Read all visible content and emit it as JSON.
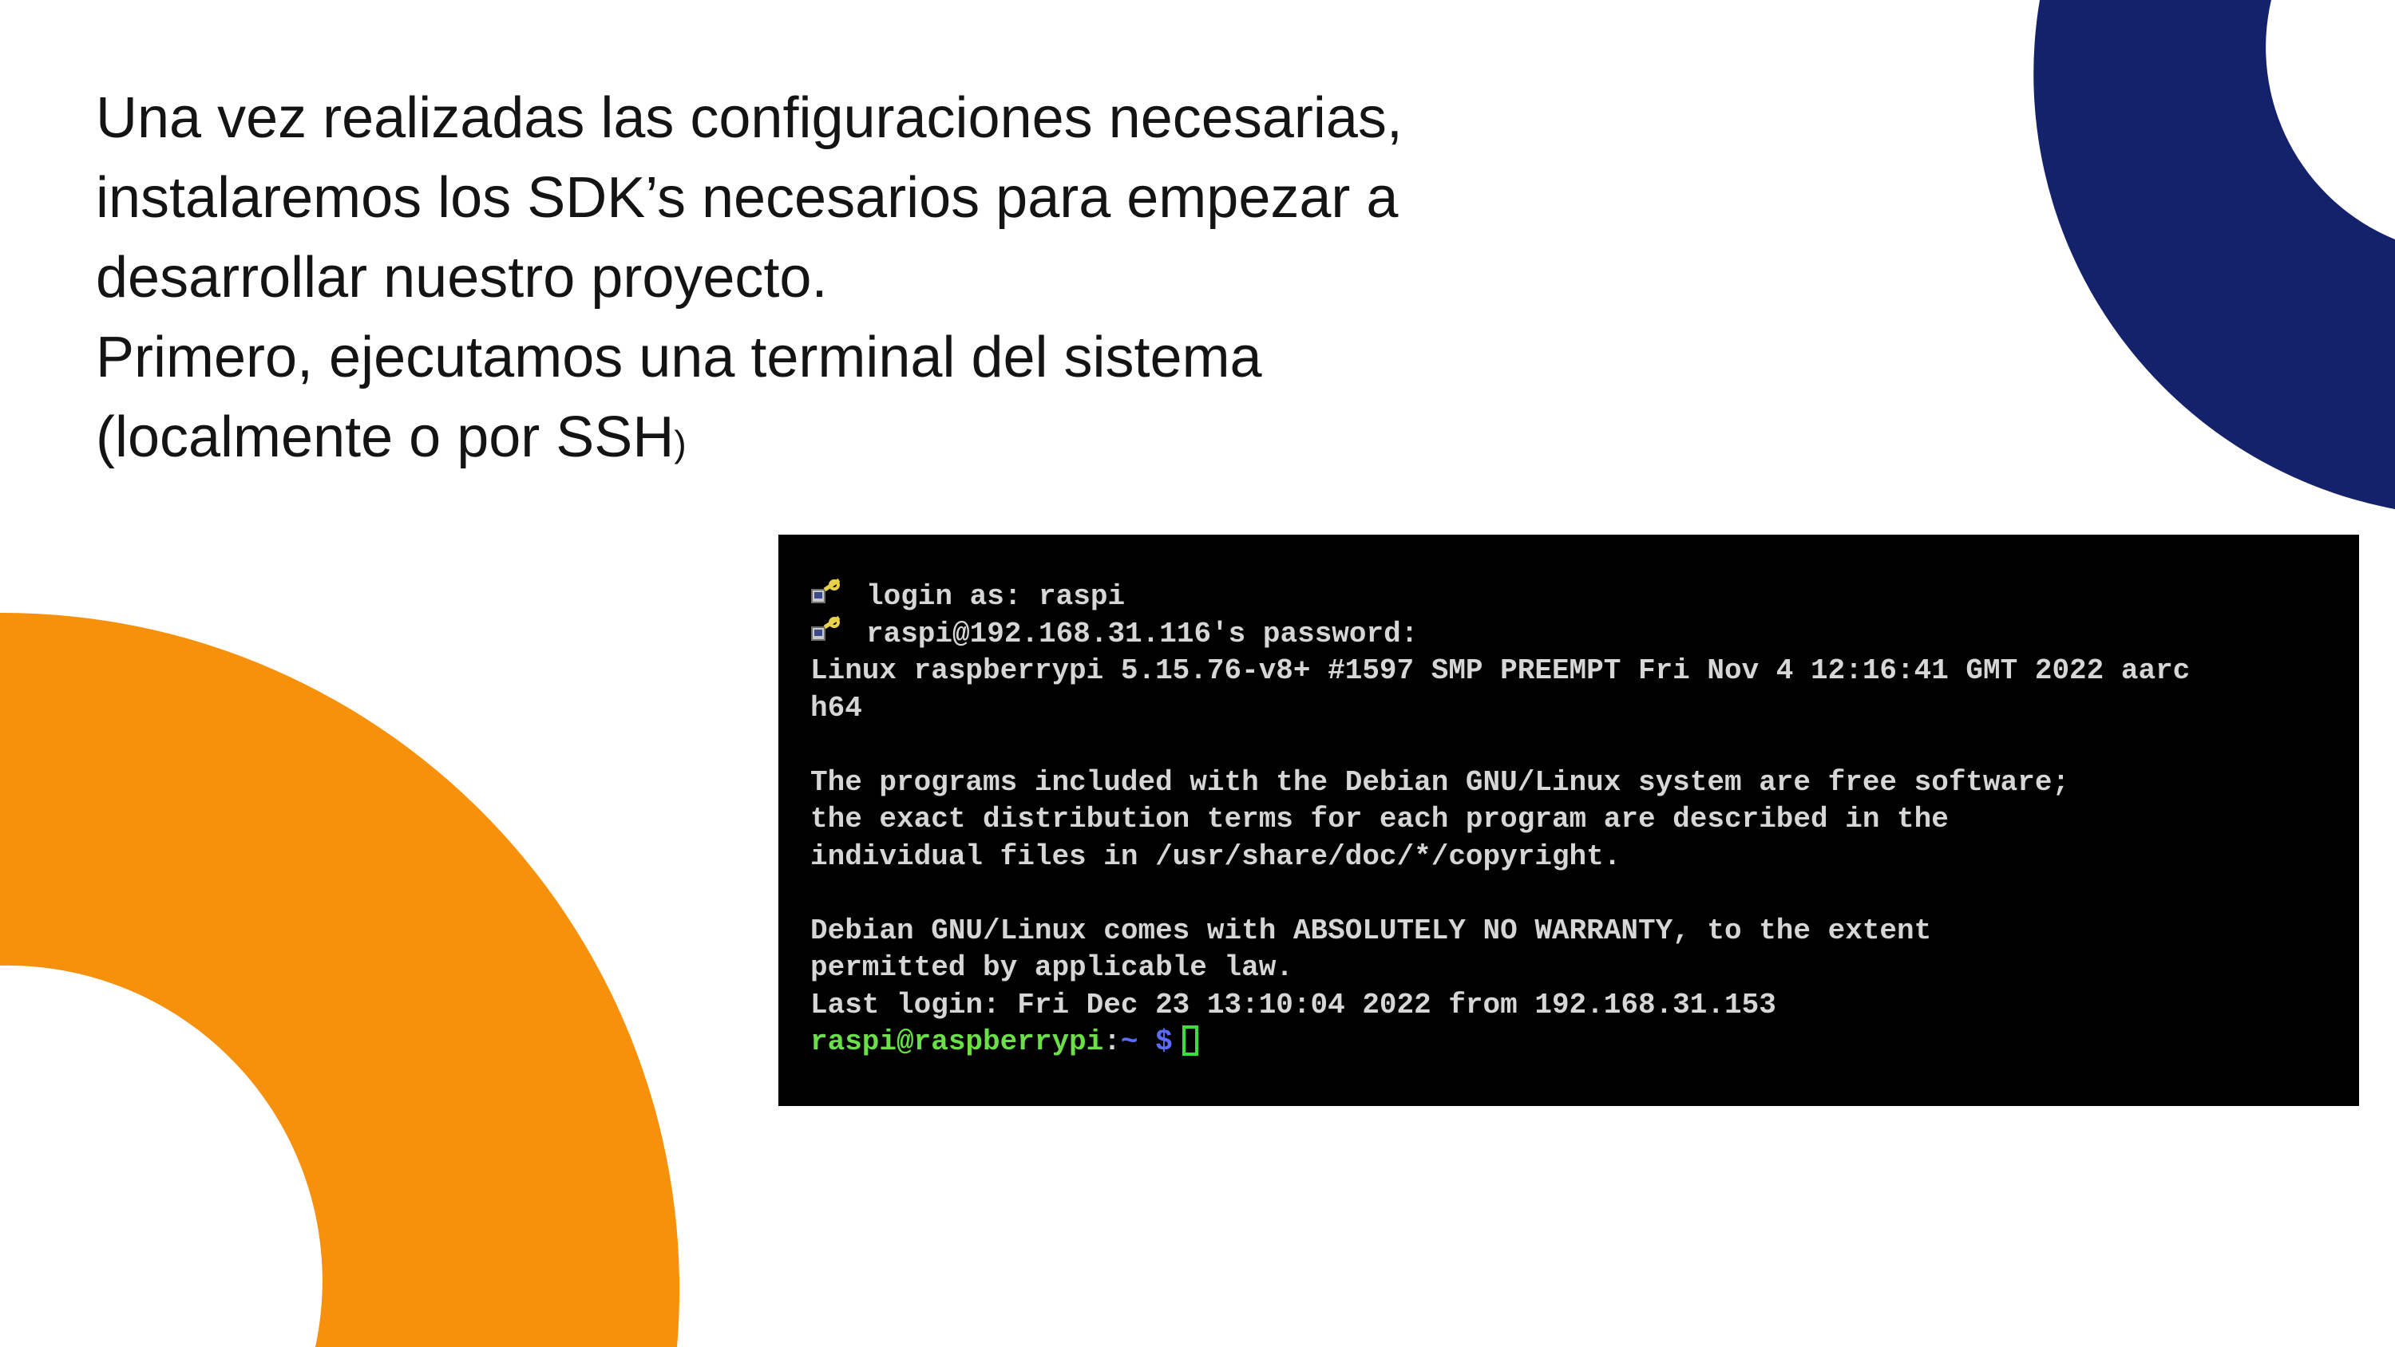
{
  "slide": {
    "heading_lines": [
      "Una vez realizadas las configuraciones necesarias,",
      "instalaremos los SDK’s necesarios para empezar a",
      "desarrollar nuestro proyecto.",
      "Primero, ejecutamos una terminal del sistema",
      "(localmente o por SSH"
    ],
    "heading_closing_paren": ")"
  },
  "terminal": {
    "login_line": "login as: raspi",
    "password_line": "raspi@192.168.31.116's password:",
    "kernel_line": "Linux raspberrypi 5.15.76-v8+ #1597 SMP PREEMPT Fri Nov 4 12:16:41 GMT 2022 aarc",
    "kernel_line_wrap": "h64",
    "license_lines": [
      "The programs included with the Debian GNU/Linux system are free software;",
      "the exact distribution terms for each program are described in the",
      "individual files in /usr/share/doc/*/copyright."
    ],
    "warranty_lines": [
      "Debian GNU/Linux comes with ABSOLUTELY NO WARRANTY, to the extent",
      "permitted by applicable law."
    ],
    "last_login": "Last login: Fri Dec 23 13:10:04 2022 from 192.168.31.153",
    "prompt_user": "raspi@raspberrypi",
    "prompt_sep": ":",
    "prompt_path": "~ $",
    "putty_icon": "putty-key-icon"
  },
  "colors": {
    "navy_arc": "#14226b",
    "orange_arc": "#f7900a",
    "terminal_bg": "#000000",
    "terminal_text": "#d6d6d6",
    "prompt_green": "#6adf48",
    "prompt_blue": "#5a6cff"
  }
}
